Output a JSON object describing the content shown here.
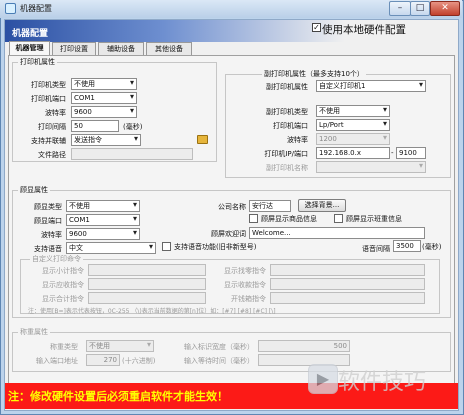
{
  "window": {
    "title": "机器配置",
    "minimize": "–",
    "maximize": "□",
    "close": "✕"
  },
  "banner": {
    "title": "机器配置",
    "use_local_label": "使用本地硬件配置",
    "use_local_checked": true
  },
  "tabs": [
    "机器管理",
    "打印设置",
    "辅助设备",
    "其他设备"
  ],
  "printer": {
    "group_title": "打印机属性",
    "type_label": "打印机类型",
    "type_value": "不使用",
    "port_label": "打印机端口",
    "port_value": "COM1",
    "baud_label": "波特率",
    "baud_value": "9600",
    "interval_label": "打印间隔",
    "interval_value": "50",
    "interval_unit": "(毫秒)",
    "parallel_label": "支持并联辅",
    "parallel_value": "发送指令",
    "path_label": "文件路径",
    "path_value": ""
  },
  "secondary": {
    "group_title": "副打印机属性（最多支持10个）",
    "props_label": "副打印机属性",
    "props_value": "自定义打印机1",
    "type_label": "副打印机类型",
    "type_value": "不使用",
    "port_label": "打印机端口",
    "port_value": "Lp/Port",
    "baud_label": "波特率",
    "baud_value": "1200",
    "ip_label": "打印机IP/端口",
    "ip_value": "192.168.0.x",
    "port_num": "9100",
    "name_label": "副打印机名称",
    "name_value": ""
  },
  "display": {
    "group_title": "顾显属性",
    "type_label": "顾显类型",
    "type_value": "不使用",
    "port_label": "顾显端口",
    "port_value": "COM1",
    "baud_label": "波特率",
    "baud_value": "9600",
    "lang_label": "支持语音",
    "lang_value": "中文",
    "company_label": "公司名称",
    "company_value": "安行达",
    "bg_button": "选择背景...",
    "show_product_info": "顾屏显示商品信息",
    "show_cn_info": "顾屏显示班重信息",
    "welcome_label": "顾屏欢迎词",
    "welcome_value": "Welcome...",
    "voice_check": "支持语音功能(旧非新型号)",
    "voice_interval_label": "语音间隔",
    "voice_interval_value": "3500",
    "voice_interval_unit": "(毫秒)"
  },
  "custom_cmd": {
    "group_title": "自定义打印命令",
    "left_labels": [
      "显示小计指令",
      "显示应收指令",
      "显示合计指令"
    ],
    "right_labels": [
      "显示找零指令",
      "显示收款指令",
      "开钱箱指令"
    ],
    "note": "注：使用[B=]表示代表按钮，0C-255 （\\)表示当前数据的第[n]位）如：[#7] [#8] [#C] [\\]"
  },
  "scale": {
    "group_title": "称重属性",
    "type_label": "称重类型",
    "type_value": "不使用",
    "width_label": "输入标识宽度（毫秒）",
    "width_value": "500",
    "addr_label": "输入端口地址",
    "addr_value": "270",
    "addr_unit": "(十六进制)",
    "wait_label": "输入等待时间（毫秒）",
    "wait_value": ""
  },
  "footer": {
    "notice": "注：修改硬件设置后必须重启软件才能生效！"
  },
  "watermark": {
    "text": "软件技巧"
  }
}
